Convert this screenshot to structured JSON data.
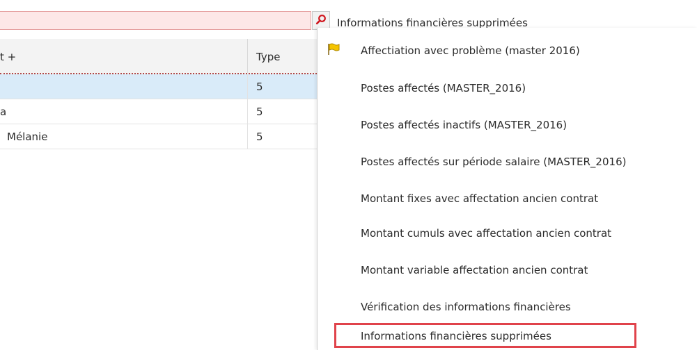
{
  "toolbar": {
    "search_value": "",
    "selected_report": "Informations financières supprimées"
  },
  "table": {
    "headers": {
      "name": "t +",
      "type": "Type"
    },
    "rows": [
      {
        "name": "",
        "type": "5"
      },
      {
        "name": "a",
        "type": "5"
      },
      {
        "name": "Mélanie",
        "type": "5"
      }
    ]
  },
  "menu": {
    "items": [
      {
        "label": "Affectiation avec problème (master 2016)",
        "icon": "flag-icon"
      },
      {
        "label": "Postes affectés (MASTER_2016)"
      },
      {
        "label": "Postes affectés inactifs (MASTER_2016)"
      },
      {
        "label": "Postes affectés sur période salaire (MASTER_2016)"
      },
      {
        "label": "Montant fixes avec affectation ancien contrat"
      },
      {
        "label": "Montant cumuls avec affectation ancien contrat"
      },
      {
        "label": "Montant variable affectation ancien contrat"
      },
      {
        "label": "Vérification des informations financières"
      },
      {
        "label": "Informations financières supprimées",
        "highlighted": true
      }
    ]
  },
  "colors": {
    "search_bg": "#fde7e7",
    "selected_row": "#d9ebf9",
    "highlight_border": "#e0434b",
    "flag_yellow": "#f5c400"
  }
}
